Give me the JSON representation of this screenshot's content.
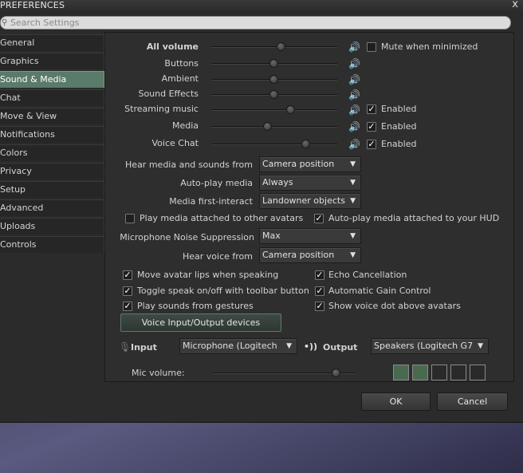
{
  "window": {
    "title": "PREFERENCES",
    "close_glyph": "x"
  },
  "search": {
    "placeholder": "Search Settings"
  },
  "sidebar": {
    "items": [
      {
        "label": "General"
      },
      {
        "label": "Graphics"
      },
      {
        "label": "Sound & Media",
        "active": true
      },
      {
        "label": "Chat"
      },
      {
        "label": "Move & View"
      },
      {
        "label": "Notifications"
      },
      {
        "label": "Colors"
      },
      {
        "label": "Privacy"
      },
      {
        "label": "Setup"
      },
      {
        "label": "Advanced"
      },
      {
        "label": "Uploads"
      },
      {
        "label": "Controls"
      }
    ]
  },
  "volumes": {
    "all": {
      "label": "All volume",
      "level": 0.56
    },
    "buttons": {
      "label": "Buttons",
      "level": 0.5
    },
    "ambient": {
      "label": "Ambient",
      "level": 0.5
    },
    "sound_effects": {
      "label": "Sound Effects",
      "level": 0.5
    },
    "streaming_music": {
      "label": "Streaming music",
      "level": 0.63
    },
    "media": {
      "label": "Media",
      "level": 0.45
    },
    "voice_chat": {
      "label": "Voice Chat",
      "level": 0.75
    },
    "speaker_icon_glyph": "🔊",
    "mute_label": "Mute when minimized",
    "mute_checked": false,
    "enabled_label": "Enabled",
    "streaming_enabled": true,
    "media_enabled": true,
    "voice_enabled": true
  },
  "media_settings": {
    "hear_from_label": "Hear media and sounds from",
    "hear_from_value": "Camera position",
    "autoplay_label": "Auto-play media",
    "autoplay_value": "Always",
    "first_interact_label": "Media first-interact",
    "first_interact_value": "Landowner objects",
    "play_attached_label": "Play media attached to other avatars",
    "play_attached_checked": false,
    "autoplay_hud_label": "Auto-play media attached to your HUD",
    "autoplay_hud_checked": true,
    "noise_label": "Microphone Noise Suppression",
    "noise_value": "Max",
    "hear_voice_label": "Hear voice from",
    "hear_voice_value": "Camera position",
    "dropdown_arrow": "▼"
  },
  "voice_options": {
    "lips_label": "Move avatar lips when speaking",
    "toggle_label": "Toggle speak on/off with toolbar button",
    "gestures_label": "Play sounds from gestures",
    "echo_label": "Echo Cancellation",
    "agc_label": "Automatic Gain Control",
    "dot_label": "Show voice dot above avatars",
    "check_glyph": "✓"
  },
  "devices": {
    "button_label": "Voice Input/Output devices",
    "input_label": "Input",
    "input_value": "Microphone (Logitech",
    "output_label": "Output",
    "output_value": "Speakers (Logitech G7",
    "mic_volume_label": "Mic volume:",
    "mic_level": 0.86,
    "meter_segments_lit": 2,
    "meter_segments_total": 5,
    "mic_icon_glyph": "🎙",
    "output_icon_glyph": "•))"
  },
  "footer": {
    "ok_label": "OK",
    "cancel_label": "Cancel"
  }
}
